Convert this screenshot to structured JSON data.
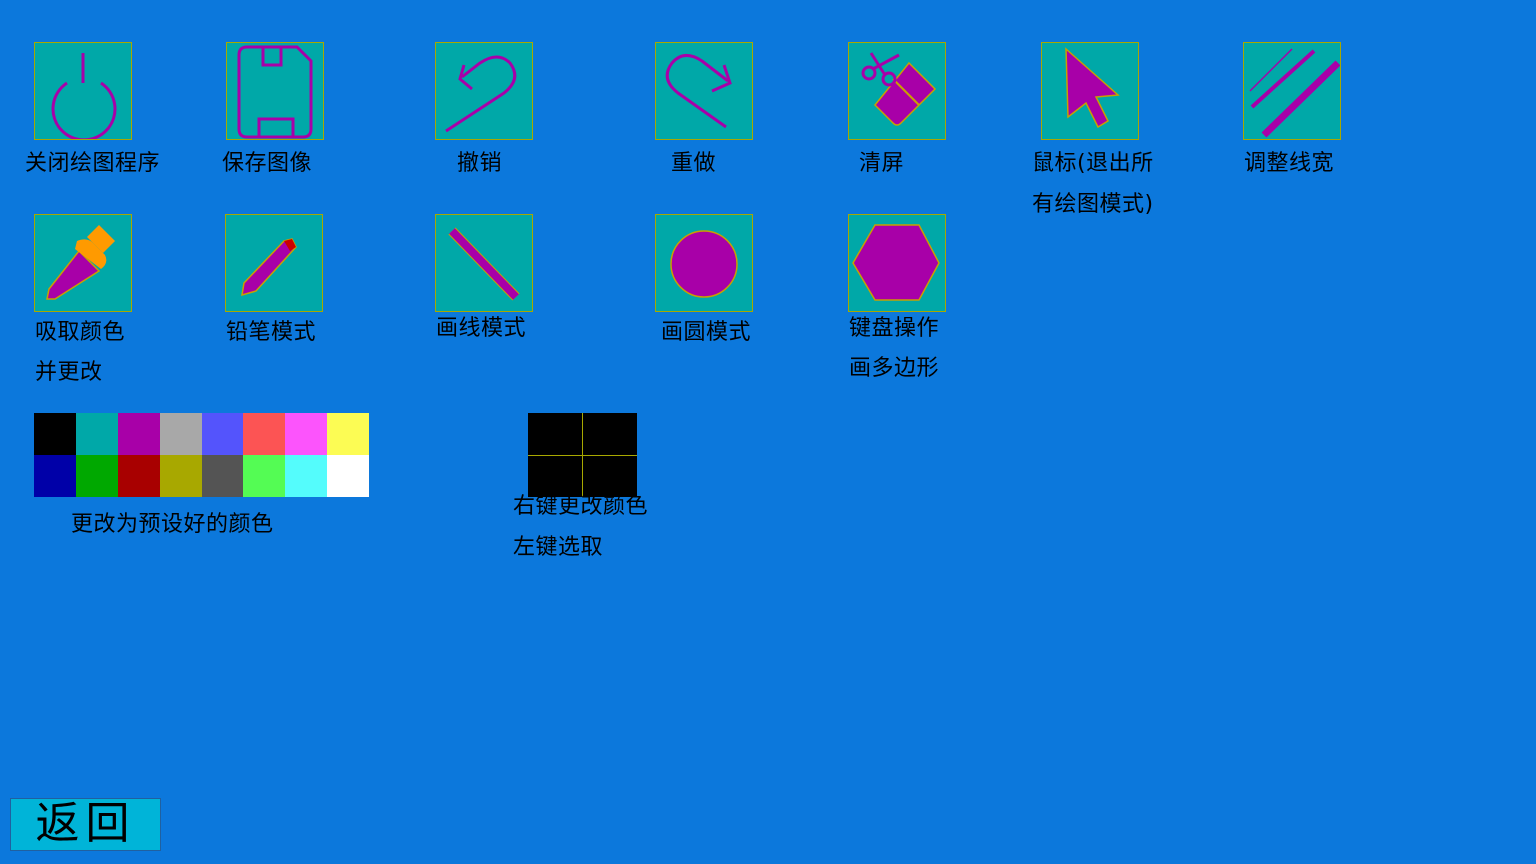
{
  "colors": {
    "background": "#0c78dc",
    "tile_fill": "#00a8a8",
    "tile_border": "#a8a800",
    "icon_stroke": "#a800a8",
    "accent_orange": "#ff9a00",
    "back_button": "#00b4d8"
  },
  "tools": [
    {
      "icon": "power-icon",
      "lines": [
        "关闭绘图程序"
      ]
    },
    {
      "icon": "save-icon",
      "lines": [
        "保存图像"
      ]
    },
    {
      "icon": "undo-icon",
      "lines": [
        "撤销"
      ]
    },
    {
      "icon": "redo-icon",
      "lines": [
        "重做"
      ]
    },
    {
      "icon": "clear-screen-icon",
      "lines": [
        "清屏"
      ]
    },
    {
      "icon": "cursor-icon",
      "lines": [
        "鼠标(退出所",
        "有绘图模式)"
      ]
    },
    {
      "icon": "line-width-icon",
      "lines": [
        "调整线宽"
      ]
    },
    {
      "icon": "eyedropper-icon",
      "lines": [
        "吸取颜色",
        "并更改"
      ]
    },
    {
      "icon": "pencil-icon",
      "lines": [
        "铅笔模式"
      ]
    },
    {
      "icon": "line-icon",
      "lines": [
        "画线模式"
      ]
    },
    {
      "icon": "circle-icon",
      "lines": [
        "画圆模式"
      ]
    },
    {
      "icon": "hexagon-icon",
      "lines": [
        "键盘操作",
        "画多边形"
      ]
    }
  ],
  "palette": {
    "label": "更改为预设好的颜色",
    "colors": [
      "#000000",
      "#00a8a8",
      "#a800a8",
      "#a8a8a8",
      "#5454fc",
      "#fc5454",
      "#fc54fc",
      "#fcfc54",
      "#0000a8",
      "#00a800",
      "#a80000",
      "#a8a800",
      "#545454",
      "#54fc54",
      "#54fcfc",
      "#ffffff"
    ]
  },
  "custom_colors": {
    "lines": [
      "右键更改颜色",
      "左键选取"
    ],
    "colors": [
      "#000000",
      "#000000",
      "#000000",
      "#000000"
    ]
  },
  "back_button": {
    "label": "返回"
  }
}
